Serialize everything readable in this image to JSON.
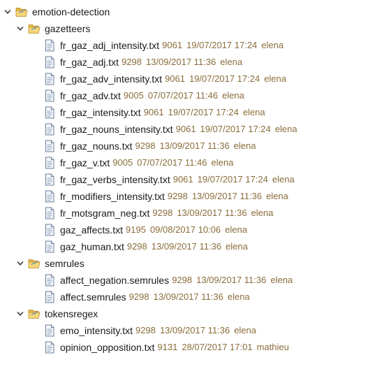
{
  "tree": {
    "root": {
      "name": "emotion-detection",
      "expanded": true,
      "folders": [
        {
          "name": "gazetteers",
          "expanded": true,
          "files": [
            {
              "name": "fr_gaz_adj_intensity.txt",
              "revision": "9061",
              "date": "19/07/2017 17:24",
              "author": "elena"
            },
            {
              "name": "fr_gaz_adj.txt",
              "revision": "9298",
              "date": "13/09/2017 11:36",
              "author": "elena"
            },
            {
              "name": "fr_gaz_adv_intensity.txt",
              "revision": "9061",
              "date": "19/07/2017 17:24",
              "author": "elena"
            },
            {
              "name": "fr_gaz_adv.txt",
              "revision": "9005",
              "date": "07/07/2017 11:46",
              "author": "elena"
            },
            {
              "name": "fr_gaz_intensity.txt",
              "revision": "9061",
              "date": "19/07/2017 17:24",
              "author": "elena"
            },
            {
              "name": "fr_gaz_nouns_intensity.txt",
              "revision": "9061",
              "date": "19/07/2017 17:24",
              "author": "elena"
            },
            {
              "name": "fr_gaz_nouns.txt",
              "revision": "9298",
              "date": "13/09/2017 11:36",
              "author": "elena"
            },
            {
              "name": "fr_gaz_v.txt",
              "revision": "9005",
              "date": "07/07/2017 11:46",
              "author": "elena"
            },
            {
              "name": "fr_gaz_verbs_intensity.txt",
              "revision": "9061",
              "date": "19/07/2017 17:24",
              "author": "elena"
            },
            {
              "name": "fr_modifiers_intensity.txt",
              "revision": "9298",
              "date": "13/09/2017 11:36",
              "author": "elena"
            },
            {
              "name": "fr_motsgram_neg.txt",
              "revision": "9298",
              "date": "13/09/2017 11:36",
              "author": "elena"
            },
            {
              "name": "gaz_affects.txt",
              "revision": "9195",
              "date": "09/08/2017 10:06",
              "author": "elena"
            },
            {
              "name": "gaz_human.txt",
              "revision": "9298",
              "date": "13/09/2017 11:36",
              "author": "elena"
            }
          ]
        },
        {
          "name": "semrules",
          "expanded": true,
          "files": [
            {
              "name": "affect_negation.semrules",
              "revision": "9298",
              "date": "13/09/2017 11:36",
              "author": "elena"
            },
            {
              "name": "affect.semrules",
              "revision": "9298",
              "date": "13/09/2017 11:36",
              "author": "elena"
            }
          ]
        },
        {
          "name": "tokensregex",
          "expanded": true,
          "files": [
            {
              "name": "emo_intensity.txt",
              "revision": "9298",
              "date": "13/09/2017 11:36",
              "author": "elena"
            },
            {
              "name": "opinion_opposition.txt",
              "revision": "9131",
              "date": "28/07/2017 17:01",
              "author": "mathieu"
            }
          ]
        }
      ]
    }
  },
  "icons": {
    "chevron": "chevron-down-icon",
    "folder": "folder-open-icon",
    "file": "text-file-icon"
  },
  "colors": {
    "metadata": "#8a6d3b",
    "folder": "#d9a43a",
    "chevron": "#3a3a3a"
  }
}
